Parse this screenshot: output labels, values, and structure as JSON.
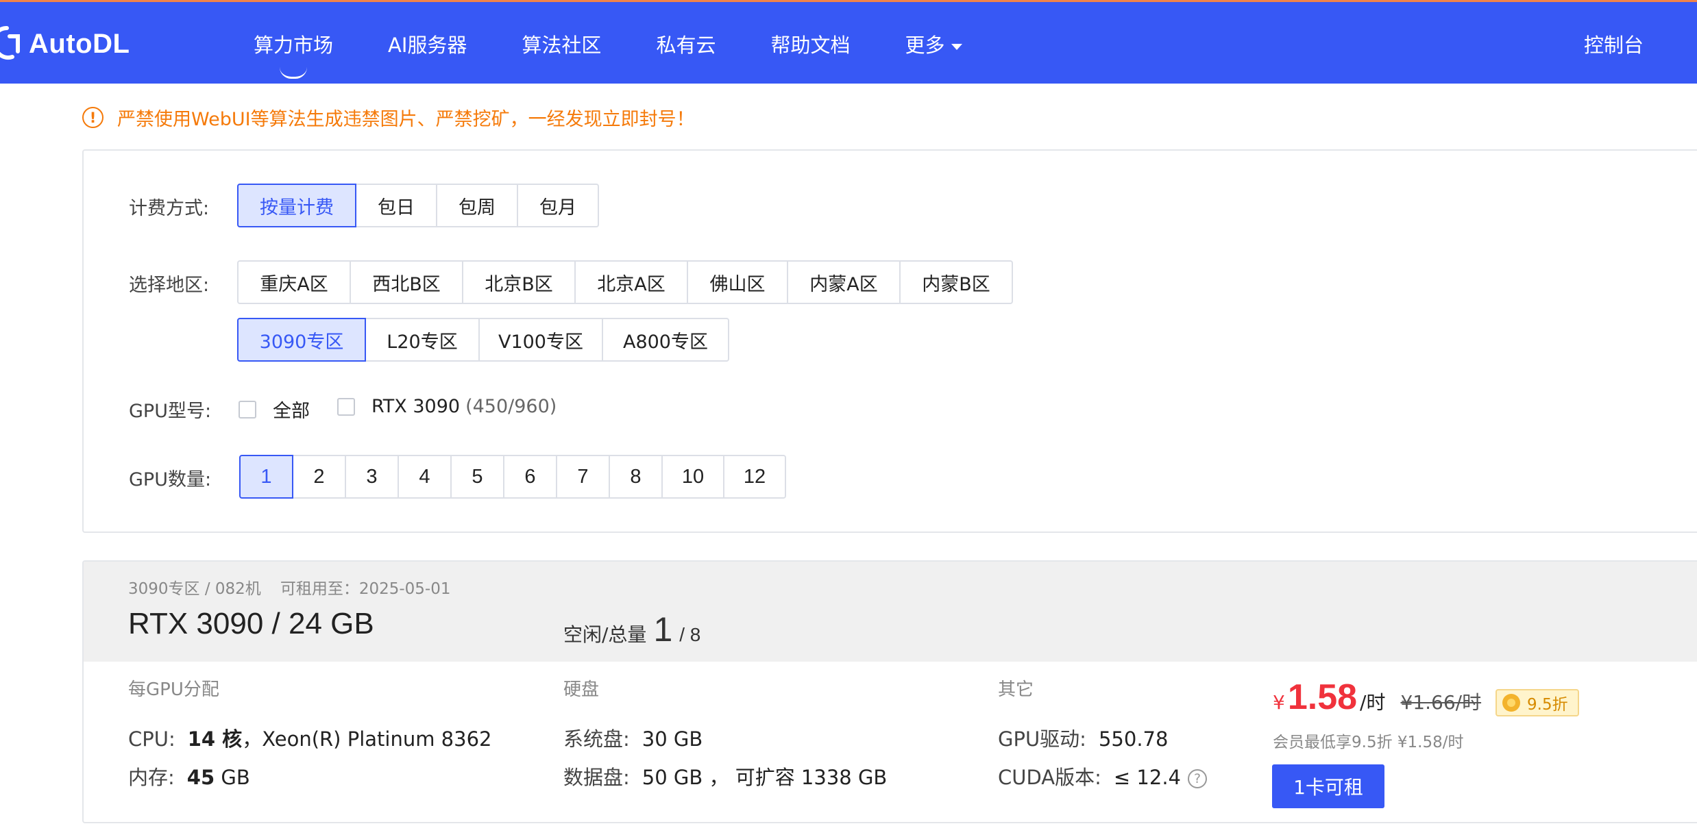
{
  "header": {
    "logo_text": "AutoDL",
    "nav": [
      {
        "label": "算力市场",
        "active": true
      },
      {
        "label": "AI服务器"
      },
      {
        "label": "算法社区"
      },
      {
        "label": "私有云"
      },
      {
        "label": "帮助文档"
      },
      {
        "label": "更多"
      }
    ],
    "console_label": "控制台"
  },
  "warning": {
    "icon": "exclamation-circle-icon",
    "text": "严禁使用WebUI等算法生成违禁图片、严禁挖矿，一经发现立即封号！"
  },
  "filter": {
    "billing": {
      "label": "计费方式:",
      "options": [
        "按量计费",
        "包日",
        "包周",
        "包月"
      ],
      "selected": "按量计费"
    },
    "region": {
      "label": "选择地区:",
      "row1": [
        "重庆A区",
        "西北B区",
        "北京B区",
        "北京A区",
        "佛山区",
        "内蒙A区",
        "内蒙B区"
      ],
      "row2": [
        "3090专区",
        "L20专区",
        "V100专区",
        "A800专区"
      ],
      "selected": "3090专区"
    },
    "gpu_model": {
      "label": "GPU型号:",
      "options": [
        {
          "label": "全部",
          "count": "",
          "checked": false
        },
        {
          "label": "RTX 3090",
          "count": "(450/960)",
          "checked": false
        }
      ]
    },
    "gpu_count": {
      "label": "GPU数量:",
      "options": [
        "1",
        "2",
        "3",
        "4",
        "5",
        "6",
        "7",
        "8",
        "10",
        "12"
      ],
      "selected": "1"
    }
  },
  "machine": {
    "location": "3090专区 / 082机",
    "expire": "可租用至：2025-05-01",
    "gpu_title": "RTX 3090 / 24 GB",
    "idle_label": "空闲/总量",
    "idle_free": "1",
    "idle_total": "/ 8",
    "per_gpu": {
      "title": "每GPU分配",
      "cpu_label": "CPU:",
      "cpu_cores": "14 核",
      "cpu_model": "，Xeon(R) Platinum 8362",
      "mem_label": "内存:",
      "mem_value": "45",
      "mem_unit": " GB"
    },
    "disk": {
      "title": "硬盘",
      "sys_label": "系统盘:",
      "sys_value": "30 GB",
      "data_label": "数据盘:",
      "data_value": "50 GB ， 可扩容 1338 GB"
    },
    "other": {
      "title": "其它",
      "driver_label": "GPU驱动:",
      "driver_value": "550.78",
      "cuda_label": "CUDA版本:",
      "cuda_value": "≤ 12.4",
      "help_icon": "question-circle-icon"
    },
    "price": {
      "currency": "¥",
      "value": "1.58",
      "unit": "/时",
      "original": "¥1.66/时",
      "discount": "9.5折",
      "member_note": "会员最低享9.5折 ¥1.58/时"
    },
    "rent_button": "1卡可租"
  },
  "colors": {
    "brand": "#3758f5",
    "warning": "#f57a0a",
    "price": "#f0323c",
    "selected_bg": "#dde5ff"
  }
}
